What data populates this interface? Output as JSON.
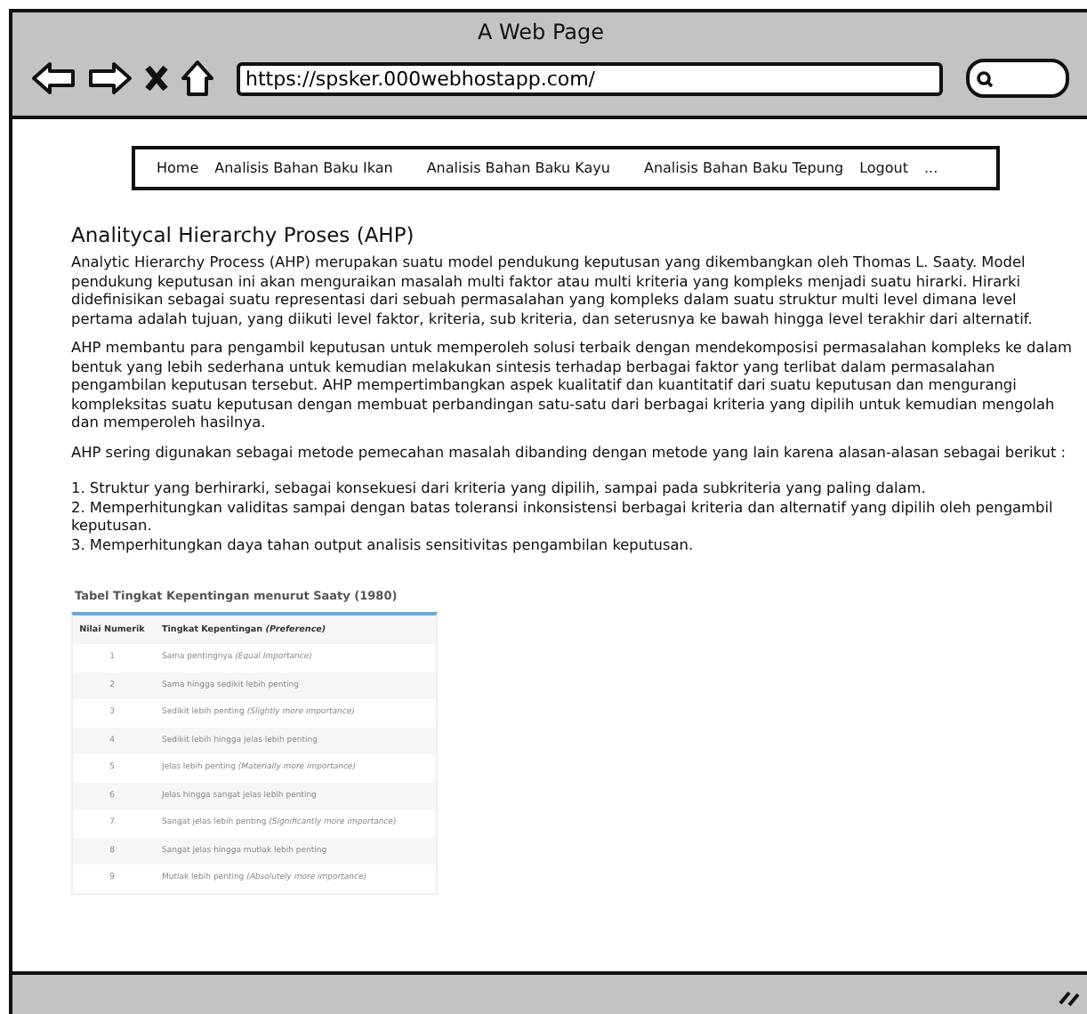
{
  "window": {
    "title": "A Web Page",
    "url": "https://spsker.000webhostapp.com/"
  },
  "nav": [
    "Home",
    "Analisis Bahan Baku Ikan",
    "Analisis Bahan Baku Kayu",
    "Analisis Bahan Baku Tepung",
    "Logout",
    "..."
  ],
  "heading": "Analitycal Hierarchy Proses (AHP)",
  "paragraphs": [
    "Analytic Hierarchy Process (AHP) merupakan suatu model pendukung keputusan yang dikembangkan oleh Thomas L. Saaty. Model pendukung keputusan ini akan menguraikan masalah multi faktor atau multi kriteria yang kompleks menjadi suatu hirarki. Hirarki didefinisikan sebagai suatu representasi dari sebuah permasalahan yang kompleks dalam suatu struktur multi level dimana level pertama adalah tujuan, yang diikuti level faktor, kriteria, sub kriteria, dan seterusnya ke bawah hingga level terakhir dari alternatif.",
    "AHP membantu para pengambil keputusan untuk memperoleh solusi terbaik dengan mendekomposisi permasalahan kompleks ke dalam bentuk yang lebih sederhana untuk kemudian melakukan sintesis terhadap berbagai faktor yang terlibat dalam permasalahan pengambilan keputusan tersebut. AHP mempertimbangkan aspek kualitatif dan kuantitatif dari suatu keputusan dan mengurangi kompleksitas suatu keputusan dengan membuat perbandingan satu-satu dari berbagai kriteria yang dipilih untuk kemudian mengolah dan memperoleh hasilnya.",
    "AHP sering digunakan sebagai metode pemecahan masalah dibanding dengan metode yang lain karena alasan-alasan sebagai berikut :"
  ],
  "reasons": [
    "1. Struktur yang berhirarki, sebagai konsekuesi dari kriteria yang dipilih, sampai pada subkriteria yang paling dalam.",
    "2. Memperhitungkan validitas sampai dengan batas toleransi inkonsistensi berbagai kriteria dan alternatif yang dipilih oleh pengambil keputusan.",
    "3. Memperhitungkan daya tahan output analisis sensitivitas pengambilan keputusan."
  ],
  "table": {
    "caption": "Tabel Tingkat Kepentingan menurut Saaty (1980)",
    "columns": [
      "Nilai Numerik",
      "Tingkat Kepentingan *(Preference)*"
    ],
    "rows": [
      [
        "1",
        "Sama pentingnya *(Equal Importance)*"
      ],
      [
        "2",
        "Sama hingga sedikit lebih penting"
      ],
      [
        "3",
        "Sedikit lebih penting *(Slightly more importance)*"
      ],
      [
        "4",
        "Sedikit lebih hingga jelas lebih penting"
      ],
      [
        "5",
        "Jelas lebih penting *(Materially more importance)*"
      ],
      [
        "6",
        "Jelas hingga sangat jelas lebih penting"
      ],
      [
        "7",
        "Sangat jelas lebih penting *(Significantly more importance)*"
      ],
      [
        "8",
        "Sangat jelas hingga mutlak lebih penting"
      ],
      [
        "9",
        "Mutlak lebih penting *(Absolutely more importance)*"
      ]
    ]
  }
}
